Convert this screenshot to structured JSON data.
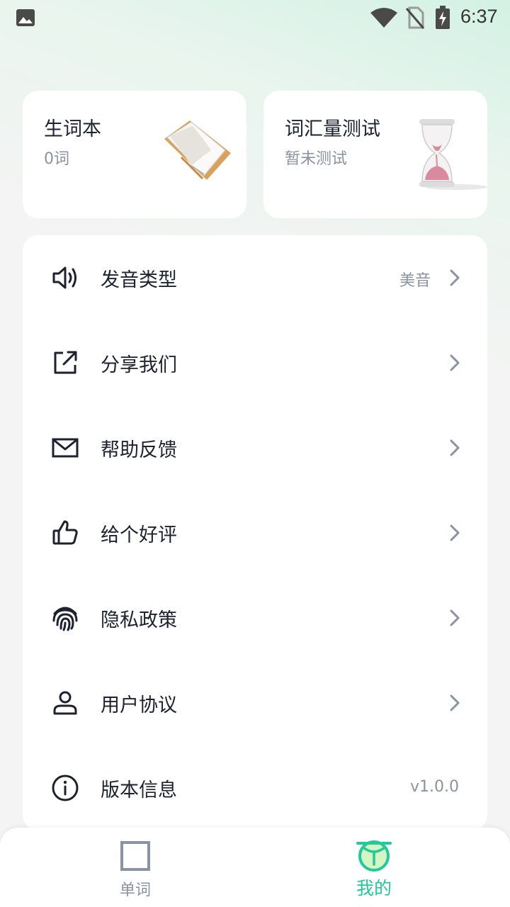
{
  "status_bar": {
    "time": "6:37",
    "icons": [
      "gallery-icon",
      "wifi-icon",
      "no-sim-icon",
      "battery-charging-icon"
    ]
  },
  "cards": {
    "vocab_book": {
      "title": "生词本",
      "subtitle": "0词",
      "image": "open-book"
    },
    "vocab_test": {
      "title": "词汇量测试",
      "subtitle": "暂未测试",
      "image": "hourglass"
    }
  },
  "menu": {
    "items": [
      {
        "label": "发音类型",
        "value": "美音",
        "icon": "speaker-icon"
      },
      {
        "label": "分享我们",
        "value": "",
        "icon": "share-icon"
      },
      {
        "label": "帮助反馈",
        "value": "",
        "icon": "mail-icon"
      },
      {
        "label": "给个好评",
        "value": "",
        "icon": "thumbs-up-icon"
      },
      {
        "label": "隐私政策",
        "value": "",
        "icon": "fingerprint-icon"
      },
      {
        "label": "用户协议",
        "value": "",
        "icon": "user-icon"
      },
      {
        "label": "版本信息",
        "value": "v1.0.0",
        "icon": "info-icon"
      }
    ]
  },
  "bottom_nav": {
    "words": {
      "label": "单词",
      "icon": "square-icon"
    },
    "mine": {
      "label": "我的",
      "icon": "mascot-icon",
      "active": true
    }
  },
  "colors": {
    "accent": "#22c99a",
    "muted_text": "#8a93a3",
    "primary_text": "#1c2230"
  }
}
